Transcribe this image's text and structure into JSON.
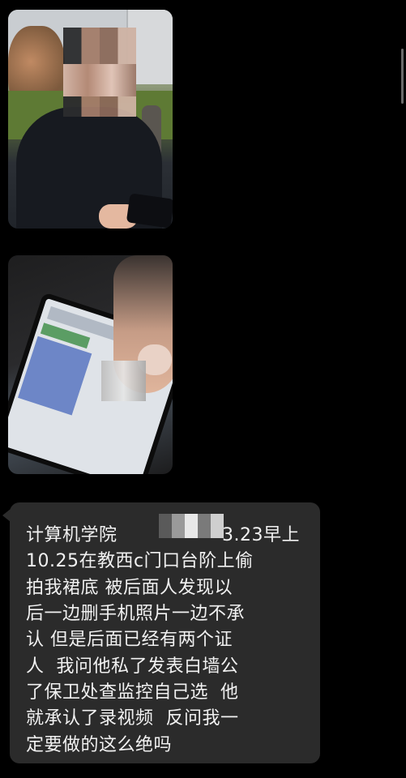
{
  "messages": [
    {
      "type": "image",
      "icon": "photo-person"
    },
    {
      "type": "image",
      "icon": "photo-phone-screen"
    },
    {
      "type": "text",
      "lines": [
        "计算机学院",
        "3.23早上",
        "10.25在教西c门口台阶上偷",
        "拍我裙底 被后面人发现以",
        "后一边删手机照片一边不承",
        "认 但是后面已经有两个证",
        "人  我问他私了发表白墙公",
        "了保卫处查监控自己选  他",
        "就承认了录视频  反问我一",
        "定要做的这么绝吗"
      ]
    }
  ],
  "colors": {
    "background": "#000000",
    "bubble": "#2b2b2b",
    "text": "#f1f1f1"
  }
}
